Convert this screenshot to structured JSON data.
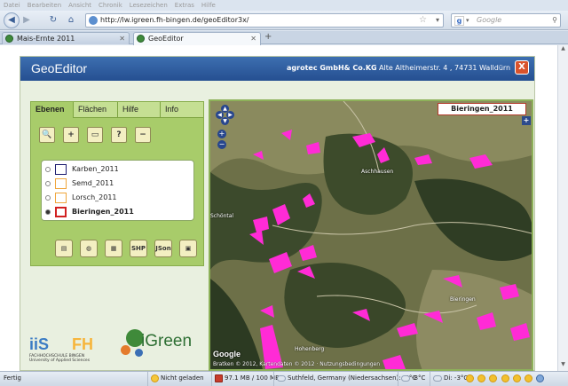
{
  "browser": {
    "menu": [
      "Datei",
      "Bearbeiten",
      "Ansicht",
      "Chronik",
      "Lesezeichen",
      "Extras",
      "Hilfe"
    ],
    "url": "http://lw.igreen.fh-bingen.de/geoEditor3x/",
    "search_placeholder": "Google",
    "tabs": [
      {
        "label": "Mais-Ernte 2011",
        "active": false
      },
      {
        "label": "GeoEditor",
        "active": true
      }
    ]
  },
  "app": {
    "title": "GeoEditor",
    "company": "agrotec GmbH& Co.KG",
    "address": "Alte Altheimerstr. 4 , 74731 Walldürn",
    "close_label": "X"
  },
  "panel": {
    "tabs": [
      "Ebenen",
      "Flächen",
      "Hilfe",
      "Info"
    ],
    "tools": [
      {
        "icon": "search-icon",
        "symbol": "🔍"
      },
      {
        "icon": "zoom-in-icon",
        "symbol": "+"
      },
      {
        "icon": "new-document-icon",
        "symbol": "▭"
      },
      {
        "icon": "help-icon",
        "symbol": "?"
      },
      {
        "icon": "zoom-out-icon",
        "symbol": "−"
      }
    ],
    "layers": [
      {
        "name": "Karben_2011",
        "color": "#1a1a6e",
        "selected": false
      },
      {
        "name": "Semd_2011",
        "color": "#f0a53a",
        "selected": false
      },
      {
        "name": "Lorsch_2011",
        "color": "#f0a53a",
        "selected": false
      },
      {
        "name": "Bieringen_2011",
        "color": "#d12020",
        "selected": true
      }
    ],
    "export": [
      {
        "icon": "print-icon",
        "label": "▤"
      },
      {
        "icon": "globe-icon",
        "label": "◍"
      },
      {
        "icon": "table-icon",
        "label": "▦"
      },
      {
        "icon": "shp-export-icon",
        "label": "SHP"
      },
      {
        "icon": "json-export-icon",
        "label": "JSon"
      },
      {
        "icon": "save-icon",
        "label": "▣"
      }
    ]
  },
  "map": {
    "active_layer": "Bieringen_2011",
    "plus_label": "+",
    "zoom_in": "+",
    "zoom_out": "−",
    "places": [
      {
        "name": "Aschhausen"
      },
      {
        "name": "Bieringen"
      },
      {
        "name": "Hohenberg"
      },
      {
        "name": "Schöntal"
      }
    ],
    "google_label": "Google",
    "copyright": "Bratken © 2012, Kartendaten © 2012 · Nutzungsbedingungen"
  },
  "logos": {
    "iis": "iiS",
    "fh": "FH",
    "fh_text": "FACHHOCHSCHULE BINGEN University of Applied Sciences",
    "igreen": "iGreen"
  },
  "statusbar": {
    "status": "Fertig",
    "load": "Nicht geladen",
    "memory": "97.1 MB / 100 MB",
    "location": "Suthfeld, Germany (Niedersachsen): -6°C",
    "temp2": "-8°C",
    "temp3": "Di: -3°C"
  },
  "colors": {
    "header": "#2d5c9f",
    "panel": "#a8cc6a",
    "field_highlight": "#ff2bd6"
  }
}
